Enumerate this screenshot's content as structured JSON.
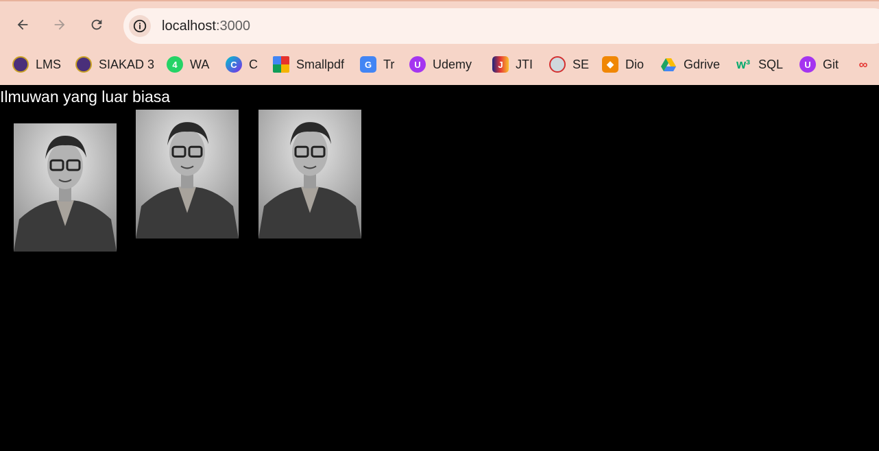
{
  "browser": {
    "url_host": "localhost",
    "url_port": ":3000",
    "bookmarks": [
      {
        "label": "LMS",
        "icon": "university-seal-icon",
        "color": "#5b3a8c"
      },
      {
        "label": "SIAKAD 3",
        "icon": "university-seal-icon",
        "color": "#5b3a8c"
      },
      {
        "label": "WA",
        "icon": "whatsapp-icon",
        "color": "#25d366"
      },
      {
        "label": "C",
        "icon": "canva-icon",
        "color": "#7d2ae8"
      },
      {
        "label": "Smallpdf",
        "icon": "smallpdf-icon",
        "color": "#e5322d"
      },
      {
        "label": "Tr",
        "icon": "translate-icon",
        "color": "#4285f4"
      },
      {
        "label": "Udemy",
        "icon": "udemy-icon",
        "color": "#a435f0"
      },
      {
        "label": "JTI",
        "icon": "jti-icon",
        "color": "#e53935"
      },
      {
        "label": "SE",
        "icon": "se-icon",
        "color": "#d32f2f"
      },
      {
        "label": "Dio",
        "icon": "diagrams-icon",
        "color": "#f08705"
      },
      {
        "label": "Gdrive",
        "icon": "google-drive-icon",
        "color": "#1fa463"
      },
      {
        "label": "SQL",
        "icon": "w3schools-icon",
        "color": "#04aa6d"
      },
      {
        "label": "Git",
        "icon": "udemy-icon",
        "color": "#a435f0"
      }
    ]
  },
  "page": {
    "title": "Ilmuwan yang luar biasa"
  }
}
